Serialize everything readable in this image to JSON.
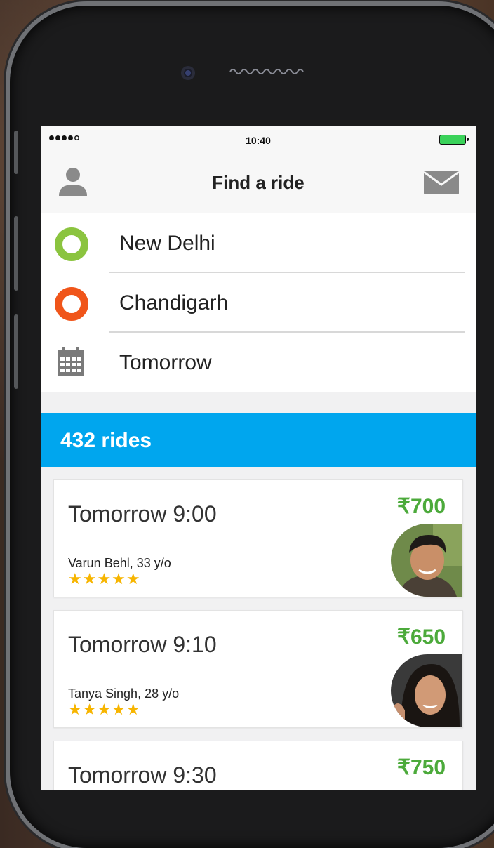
{
  "status_bar": {
    "time": "10:40"
  },
  "navbar": {
    "title": "Find a ride",
    "left_icon": "user-icon",
    "right_icon": "mail-icon"
  },
  "search": {
    "from": "New Delhi",
    "to": "Chandigarh",
    "date": "Tomorrow"
  },
  "results": {
    "count_label": "432 rides",
    "rides": [
      {
        "time": "Tomorrow 9:00",
        "price": "₹700",
        "driver": "Varun Behl, 33 y/o",
        "stars": "★★★★★",
        "rating": 5
      },
      {
        "time": "Tomorrow 9:10",
        "price": "₹650",
        "driver": "Tanya Singh, 28 y/o",
        "stars": "★★★★★",
        "rating": 5
      },
      {
        "time": "Tomorrow 9:30",
        "price": "₹750",
        "driver": "",
        "stars": "",
        "rating": null
      }
    ]
  },
  "colors": {
    "accent": "#00a6ee",
    "price": "#4caa3b",
    "from": "#8bc43f",
    "to": "#f0551a",
    "star": "#f7b500"
  }
}
